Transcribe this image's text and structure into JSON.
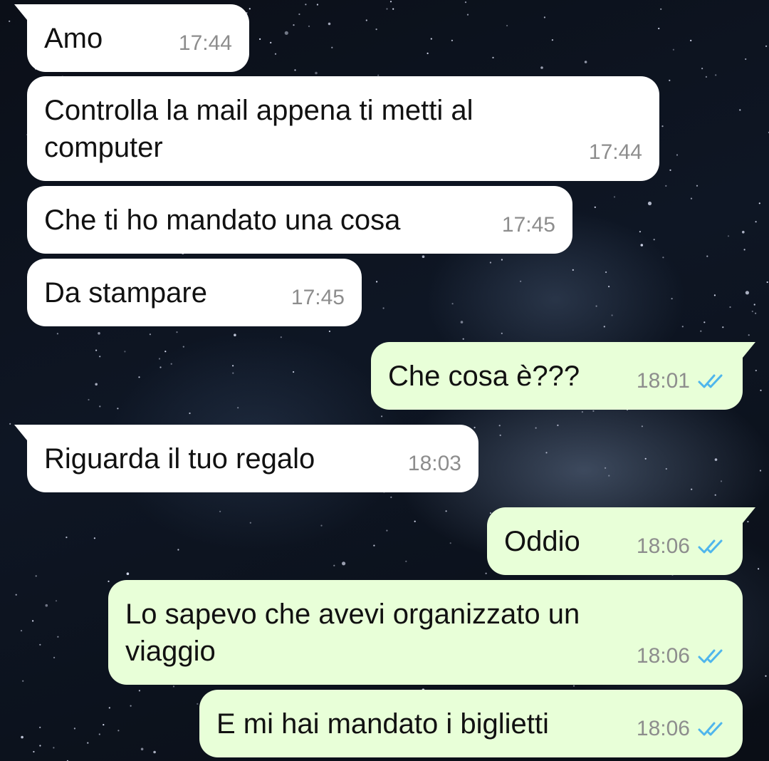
{
  "colors": {
    "incoming_bubble": "#ffffff",
    "outgoing_bubble": "#e8ffd8",
    "timestamp": "#8d8d8d",
    "read_ticks": "#4fb6ec"
  },
  "messages": [
    {
      "direction": "incoming",
      "text": "Amo",
      "time": "17:44"
    },
    {
      "direction": "incoming",
      "text": "Controlla la mail appena ti metti al\ncomputer",
      "time": "17:44"
    },
    {
      "direction": "incoming",
      "text": "Che ti ho mandato una cosa",
      "time": "17:45"
    },
    {
      "direction": "incoming",
      "text": "Da stampare",
      "time": "17:45"
    },
    {
      "direction": "outgoing",
      "text": "Che cosa è???",
      "time": "18:01",
      "status": "read"
    },
    {
      "direction": "incoming",
      "text": "Riguarda il tuo regalo",
      "time": "18:03"
    },
    {
      "direction": "outgoing",
      "text": "Oddio",
      "time": "18:06",
      "status": "read"
    },
    {
      "direction": "outgoing",
      "text": "Lo sapevo che avevi organizzato un\nviaggio",
      "time": "18:06",
      "status": "read"
    },
    {
      "direction": "outgoing",
      "text": "E mi hai mandato i biglietti",
      "time": "18:06",
      "status": "read"
    }
  ]
}
